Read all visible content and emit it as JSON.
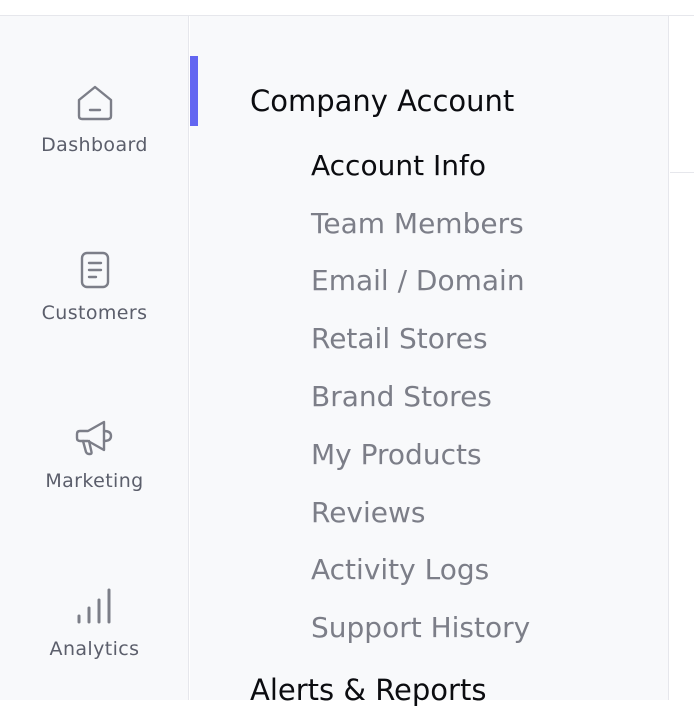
{
  "rail": {
    "items": [
      {
        "label": "Dashboard",
        "icon": "home-icon"
      },
      {
        "label": "Customers",
        "icon": "document-icon"
      },
      {
        "label": "Marketing",
        "icon": "megaphone-icon"
      },
      {
        "label": "Analytics",
        "icon": "bar-chart-icon"
      }
    ]
  },
  "settings_nav": {
    "section": "Company Account",
    "items": [
      {
        "label": "Account Info",
        "active": true
      },
      {
        "label": "Team Members"
      },
      {
        "label": "Email / Domain"
      },
      {
        "label": "Retail Stores"
      },
      {
        "label": "Brand Stores"
      },
      {
        "label": "My Products"
      },
      {
        "label": "Reviews"
      },
      {
        "label": "Activity Logs"
      },
      {
        "label": "Support History"
      }
    ],
    "next_section": "Alerts & Reports"
  },
  "colors": {
    "accent": "#6366f1",
    "active_text": "#0b0c10",
    "inactive_text": "#7c7e88",
    "rail_text": "#5b5e6b",
    "panel_bg": "#f8f9fb"
  }
}
